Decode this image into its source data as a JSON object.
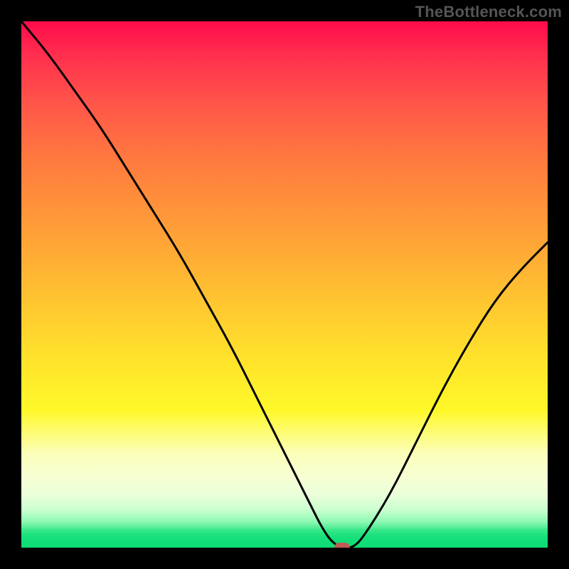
{
  "watermark": "TheBottleneck.com",
  "colors": {
    "background": "#000000",
    "gradient_top": "#ff0b4a",
    "gradient_mid": "#ffe22b",
    "gradient_low": "#fcffb9",
    "gradient_bottom": "#0bdc74",
    "curve": "#000000",
    "marker": "#c05a56",
    "watermark": "#555555"
  },
  "chart_data": {
    "type": "line",
    "title": "",
    "xlabel": "",
    "ylabel": "",
    "xlim": [
      0,
      100
    ],
    "ylim": [
      0,
      100
    ],
    "grid": false,
    "legend": false,
    "series": [
      {
        "name": "bottleneck-curve",
        "x": [
          0,
          5,
          10,
          15,
          20,
          25,
          30,
          35,
          40,
          45,
          50,
          55,
          57,
          59,
          61,
          63,
          65,
          70,
          75,
          80,
          85,
          90,
          95,
          100
        ],
        "y": [
          100,
          94,
          87,
          80,
          72,
          64,
          56,
          47,
          38,
          28,
          18,
          8,
          4,
          1,
          0,
          0,
          2,
          10,
          20,
          30,
          39,
          47,
          53,
          58
        ]
      }
    ],
    "marker": {
      "x": 61,
      "y": 0
    },
    "annotations": []
  }
}
